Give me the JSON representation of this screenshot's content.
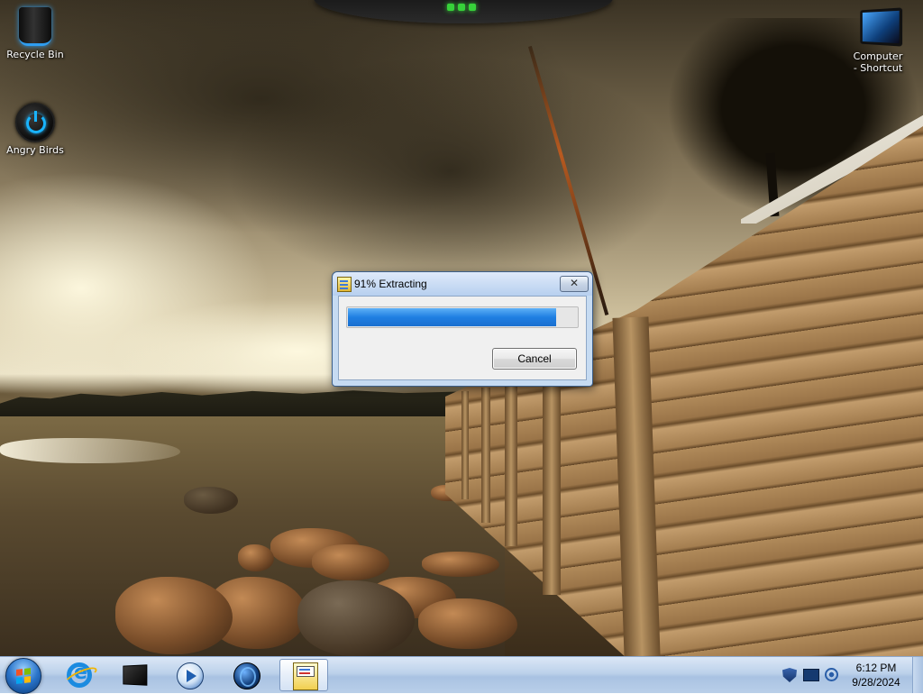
{
  "desktop": {
    "icons": [
      {
        "label": "Recycle Bin",
        "icon": "recycle-bin-icon"
      },
      {
        "label": "Angry Birds",
        "icon": "power-icon"
      },
      {
        "label": "Computer - Shortcut",
        "icon": "monitor-icon"
      }
    ]
  },
  "dialog": {
    "title": "91% Extracting",
    "progress": 0.91,
    "cancel_label": "Cancel",
    "close_symbol": "✕",
    "accent": "#1f7fe2"
  },
  "taskbar": {
    "items": [
      {
        "name": "start-button",
        "icon": "windows-logo-icon"
      },
      {
        "name": "internet-explorer",
        "icon": "internet-explorer-icon"
      },
      {
        "name": "dark-monitor",
        "icon": "monitor-icon"
      },
      {
        "name": "media-player",
        "icon": "play-icon"
      },
      {
        "name": "globe-app",
        "icon": "globe-icon"
      },
      {
        "name": "setup-extracting",
        "icon": "installer-icon",
        "active": true
      }
    ],
    "tray": {
      "icons": [
        "shield-icon",
        "network-icon",
        "volume-icon"
      ],
      "time": "6:12 PM",
      "date": "9/28/2024"
    }
  }
}
